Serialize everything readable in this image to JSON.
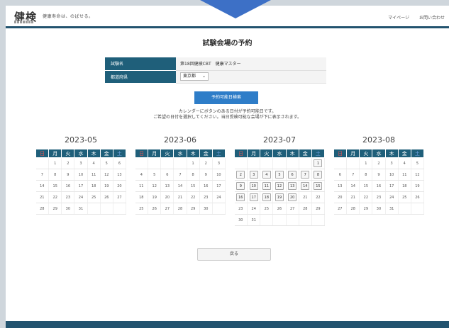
{
  "header": {
    "logo": "健検",
    "tagline": "健康寿命は、のばせる。",
    "nav": [
      "マイページ",
      "お問い合わせ"
    ]
  },
  "page_title": "試験会場の予約",
  "form": {
    "exam_label": "試験名",
    "exam_value": "第18回健検CBT　健康マスター",
    "prefecture_label": "都道府県",
    "prefecture_value": "東京都"
  },
  "search_button": "予約可能日検索",
  "info": [
    "カレンダーにボタンのある日付が予約可能日です。",
    "ご希望の日付を選択してください。当日受検可能な会場が下に表示されます。"
  ],
  "weekdays": [
    "日",
    "月",
    "火",
    "水",
    "木",
    "金",
    "土"
  ],
  "calendars": [
    {
      "title": "2023-05",
      "weeks": [
        [
          "",
          "1",
          "2",
          "3",
          "4",
          "5",
          "6"
        ],
        [
          "7",
          "8",
          "9",
          "10",
          "11",
          "12",
          "13"
        ],
        [
          "14",
          "15",
          "16",
          "17",
          "18",
          "19",
          "20"
        ],
        [
          "21",
          "22",
          "23",
          "24",
          "25",
          "26",
          "27"
        ],
        [
          "28",
          "29",
          "30",
          "31",
          "",
          "",
          ""
        ]
      ],
      "buttons": []
    },
    {
      "title": "2023-06",
      "weeks": [
        [
          "",
          "",
          "",
          "",
          "1",
          "2",
          "3"
        ],
        [
          "4",
          "5",
          "6",
          "7",
          "8",
          "9",
          "10"
        ],
        [
          "11",
          "12",
          "13",
          "14",
          "15",
          "16",
          "17"
        ],
        [
          "18",
          "19",
          "20",
          "21",
          "22",
          "23",
          "24"
        ],
        [
          "25",
          "26",
          "27",
          "28",
          "29",
          "30",
          ""
        ]
      ],
      "buttons": []
    },
    {
      "title": "2023-07",
      "weeks": [
        [
          "",
          "",
          "",
          "",
          "",
          "",
          "1"
        ],
        [
          "2",
          "3",
          "4",
          "5",
          "6",
          "7",
          "8"
        ],
        [
          "9",
          "10",
          "11",
          "12",
          "13",
          "14",
          "15"
        ],
        [
          "16",
          "17",
          "18",
          "19",
          "20",
          "21",
          "22"
        ],
        [
          "23",
          "24",
          "25",
          "26",
          "27",
          "28",
          "29"
        ],
        [
          "30",
          "31",
          "",
          "",
          "",
          "",
          ""
        ]
      ],
      "buttons": [
        "1",
        "2",
        "3",
        "4",
        "5",
        "6",
        "7",
        "8",
        "9",
        "10",
        "11",
        "12",
        "13",
        "14",
        "15",
        "16",
        "17",
        "18",
        "19",
        "20"
      ]
    },
    {
      "title": "2023-08",
      "weeks": [
        [
          "",
          "",
          "1",
          "2",
          "3",
          "4",
          "5"
        ],
        [
          "6",
          "7",
          "8",
          "9",
          "10",
          "11",
          "12"
        ],
        [
          "13",
          "14",
          "15",
          "16",
          "17",
          "18",
          "19"
        ],
        [
          "20",
          "21",
          "22",
          "23",
          "24",
          "25",
          "26"
        ],
        [
          "27",
          "28",
          "29",
          "30",
          "31",
          "",
          ""
        ]
      ],
      "buttons": []
    }
  ],
  "back_button": "戻る",
  "colors": {
    "header_bar": "#22536f",
    "table_head": "#1f5f7a",
    "search_button": "#2e7dc8",
    "arrow": "#3d70c6"
  }
}
